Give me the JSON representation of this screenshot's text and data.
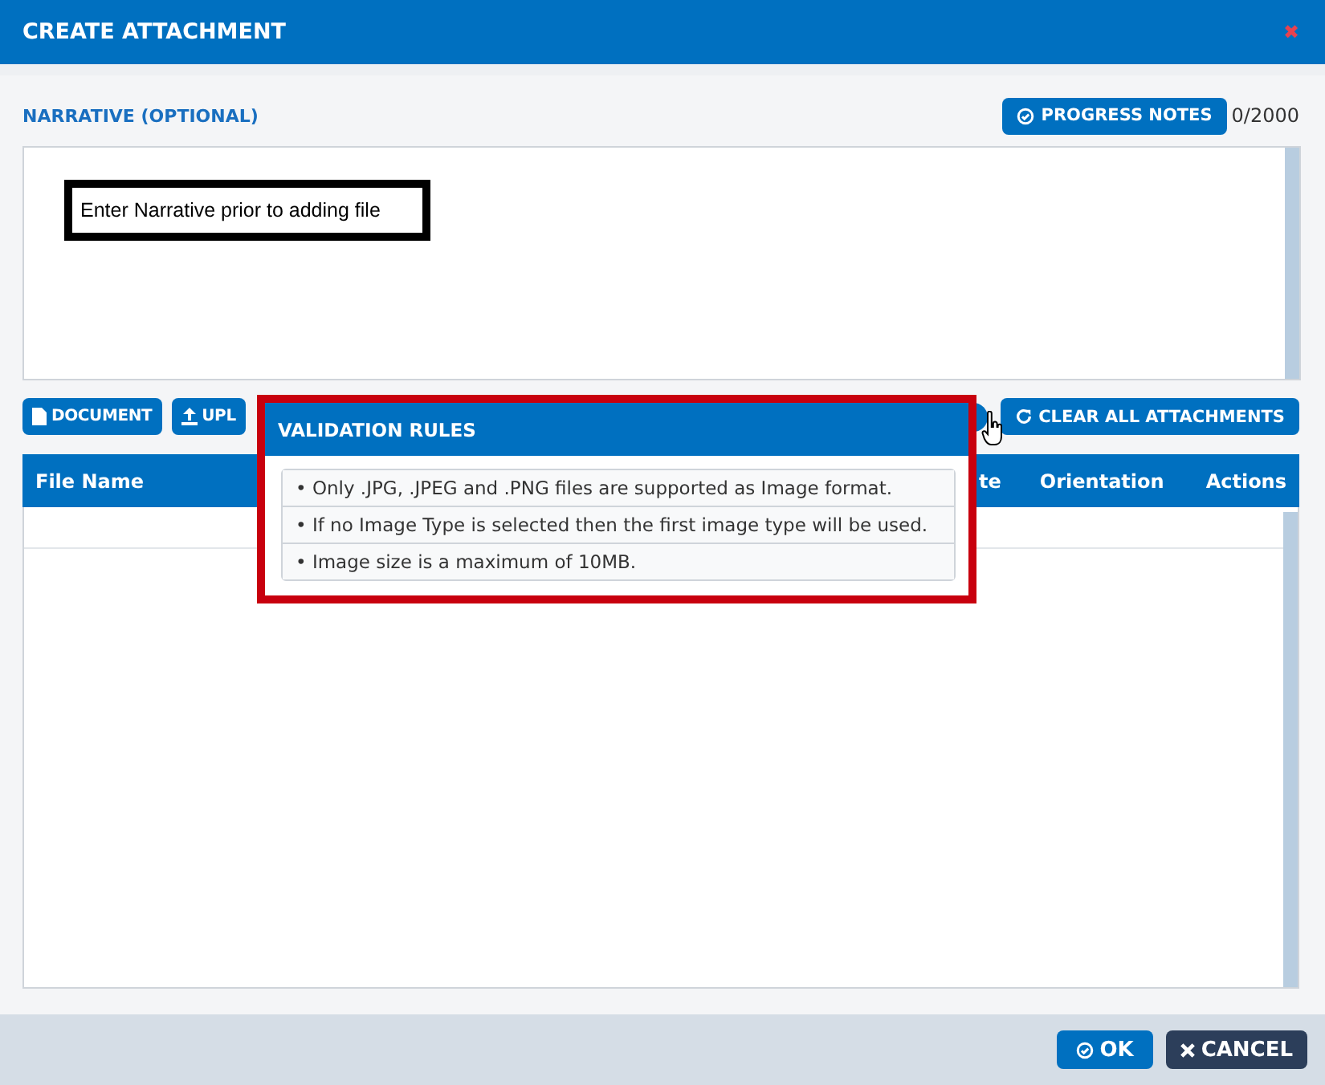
{
  "window": {
    "title": "CREATE ATTACHMENT",
    "close": "✖"
  },
  "narrative": {
    "label": "NARRATIVE (OPTIONAL)",
    "progress_button": "PROGRESS NOTES",
    "counter": "0/2000",
    "callout": "Enter Narrative prior to adding file"
  },
  "toolbar": {
    "buttons": [
      "DOCUMENT",
      "UPL"
    ],
    "clear_button": "CLEAR ALL ATTACHMENTS"
  },
  "table": {
    "columns": [
      "File Name",
      "te",
      "Orientation",
      "Actions"
    ]
  },
  "popup": {
    "title": "VALIDATION RULES",
    "rules": [
      "• Only .JPG, .JPEG and .PNG files are supported as Image format.",
      "• If no Image Type is selected then the first image type will be used.",
      "• Image size is a maximum of 10MB."
    ]
  },
  "footer": {
    "ok": "OK",
    "cancel": "CANCEL"
  }
}
